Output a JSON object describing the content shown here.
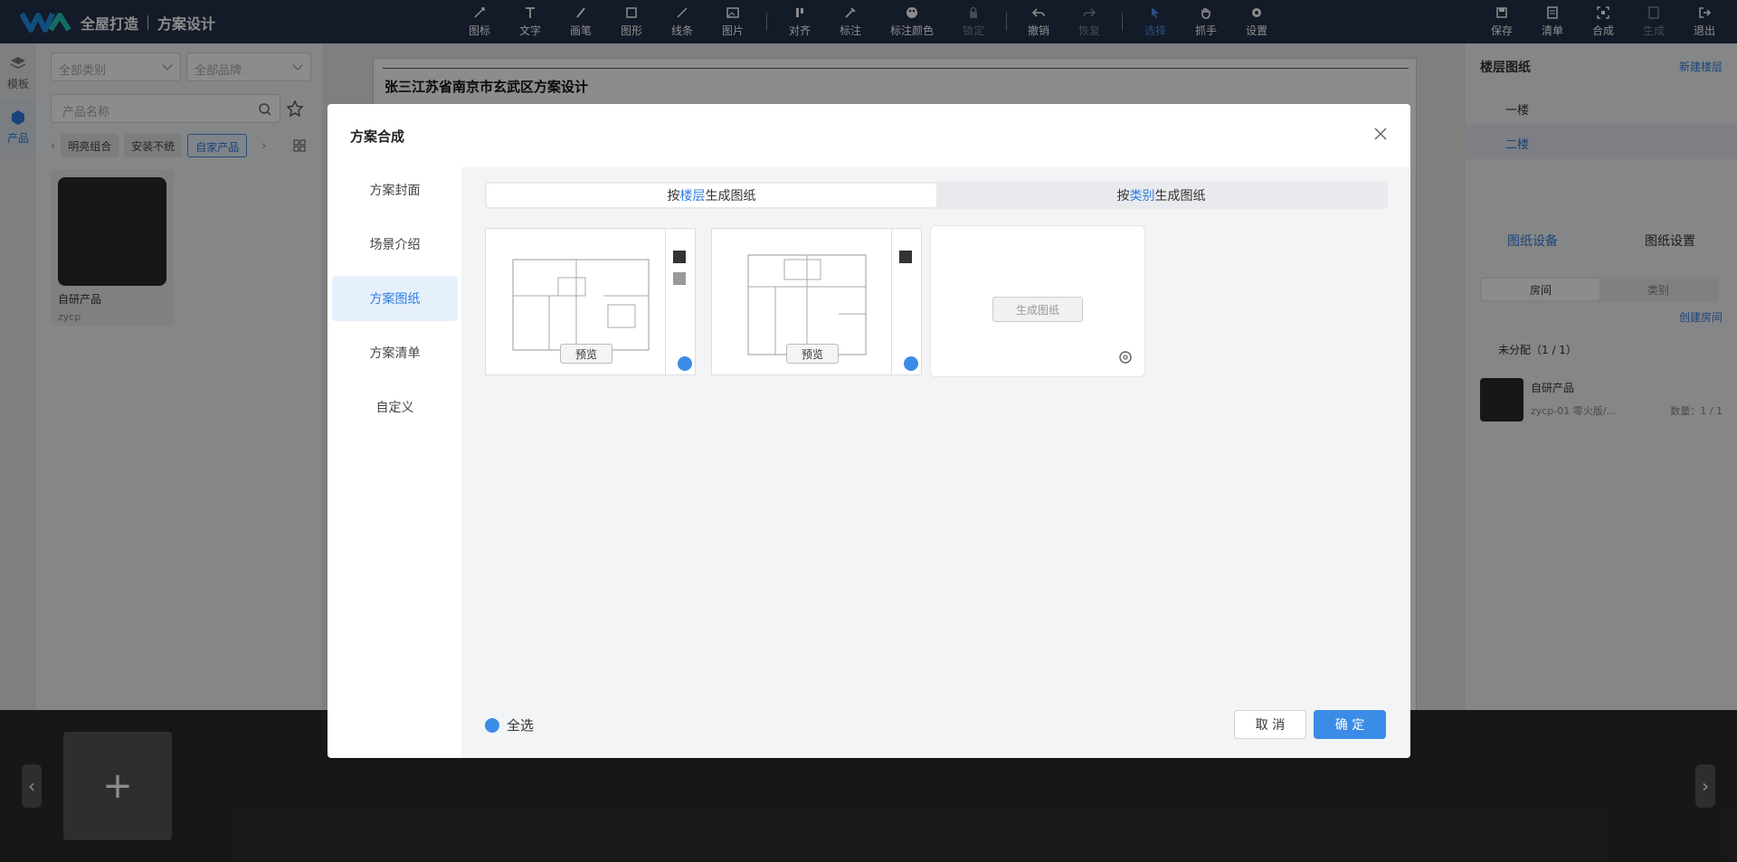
{
  "topbar": {
    "brand": "全屋打造",
    "page": "方案设计",
    "tools": [
      "图标",
      "文字",
      "画笔",
      "图形",
      "线条",
      "图片",
      "对齐",
      "标注",
      "标注颜色",
      "锁定",
      "撤销",
      "恢复",
      "选择",
      "抓手",
      "设置"
    ],
    "right_tools": [
      "保存",
      "清单",
      "合成",
      "生成",
      "退出"
    ]
  },
  "left_rail": {
    "templates": "模板",
    "products": "产品"
  },
  "left_panel": {
    "category": "全部类别",
    "brand": "全部品牌",
    "search_placeholder": "产品名称",
    "tags": [
      "明亮组合",
      "安装不统",
      "自家产品"
    ],
    "product_name": "自研产品",
    "product_code": "zycp"
  },
  "sheet": {
    "title": "张三江苏省南京市玄武区方案设计"
  },
  "right_panel": {
    "floor_title": "楼层图纸",
    "new_floor": "新建楼层",
    "floors": [
      "一楼",
      "二楼"
    ],
    "tab_devices": "图纸设备",
    "tab_settings": "图纸设置",
    "seg_room": "房间",
    "seg_category": "类别",
    "create_room": "创建房间",
    "unassigned": "未分配（1 / 1）",
    "device_name": "自研产品",
    "device_desc": "zycp-01 零火版/...",
    "device_qty": "数量：1 / 1"
  },
  "modal": {
    "title": "方案合成",
    "nav": [
      "方案封面",
      "场景介绍",
      "方案图纸",
      "方案清单",
      "自定义"
    ],
    "seg_floor_prefix": "按",
    "seg_floor_key": "楼层",
    "seg_floor_suffix": "生成图纸",
    "seg_cat_prefix": "按",
    "seg_cat_key": "类别",
    "seg_cat_suffix": "生成图纸",
    "preview": "预览",
    "generate": "生成图纸",
    "select_all": "全选",
    "cancel": "取 消",
    "ok": "确 定"
  }
}
